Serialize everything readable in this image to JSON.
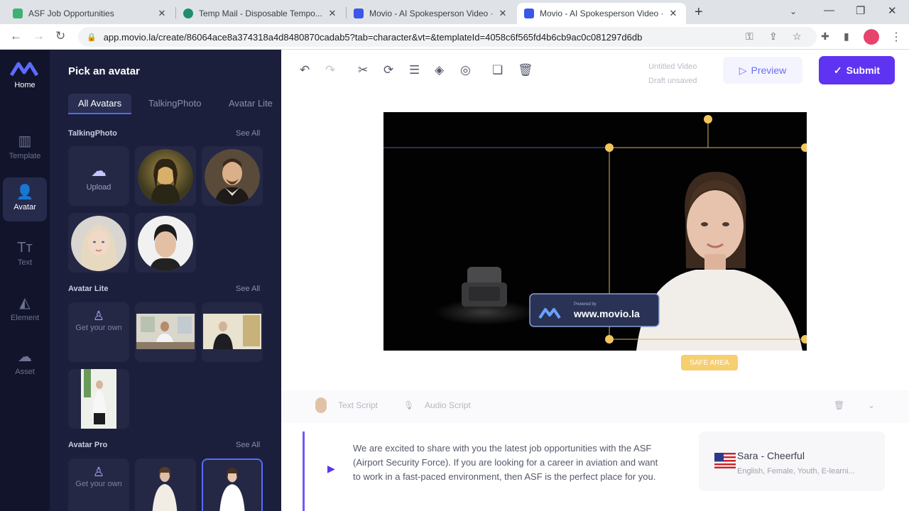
{
  "browser": {
    "tabs": [
      {
        "title": "ASF Job Opportunities",
        "color": "#3cb371"
      },
      {
        "title": "Temp Mail - Disposable Tempo...",
        "color": "#1f8f6b"
      },
      {
        "title": "Movio - AI Spokesperson Video ·",
        "color": "#3a57e8"
      },
      {
        "title": "Movio - AI Spokesperson Video ·",
        "color": "#3a57e8"
      }
    ],
    "url": "app.movio.la/create/86064ace8a374318a4d8480870cadab5?tab=character&vt=&templateId=4058c6f565fd4b6cb9ac0c081297d6db"
  },
  "rail": {
    "home": "Home",
    "template": "Template",
    "avatar": "Avatar",
    "text": "Text",
    "element": "Element",
    "asset": "Asset"
  },
  "panel": {
    "title": "Pick an avatar",
    "tabs": [
      "All Avatars",
      "TalkingPhoto",
      "Avatar Lite"
    ],
    "sections": {
      "talking_photo": "TalkingPhoto",
      "avatar_lite": "Avatar Lite",
      "avatar_pro": "Avatar Pro"
    },
    "see_all": "See All",
    "upload": "Upload",
    "get_your_own": "Get your own"
  },
  "editor": {
    "doc_title": "Untitled Video",
    "doc_status": "Draft unsaved",
    "preview": "Preview",
    "submit": "Submit",
    "watermark": "www.movio.la",
    "watermark_small": "Powered by",
    "safe_badge": "SAFE AREA",
    "script_tabs": {
      "text": "Text Script",
      "audio": "Audio Script"
    },
    "script": "We are excited to share with you the latest job opportunities with the ASF (Airport Security Force). If you are looking for a career in aviation and want to work in a fast-paced environment, then ASF is the perfect place for you.",
    "voice": {
      "name": "Sara - Cheerful",
      "desc": "English, Female, Youth, E-learni..."
    }
  },
  "colors": {
    "accent": "#5e33f1",
    "sidebar": "#11142b",
    "panel": "#1b1f3b"
  }
}
